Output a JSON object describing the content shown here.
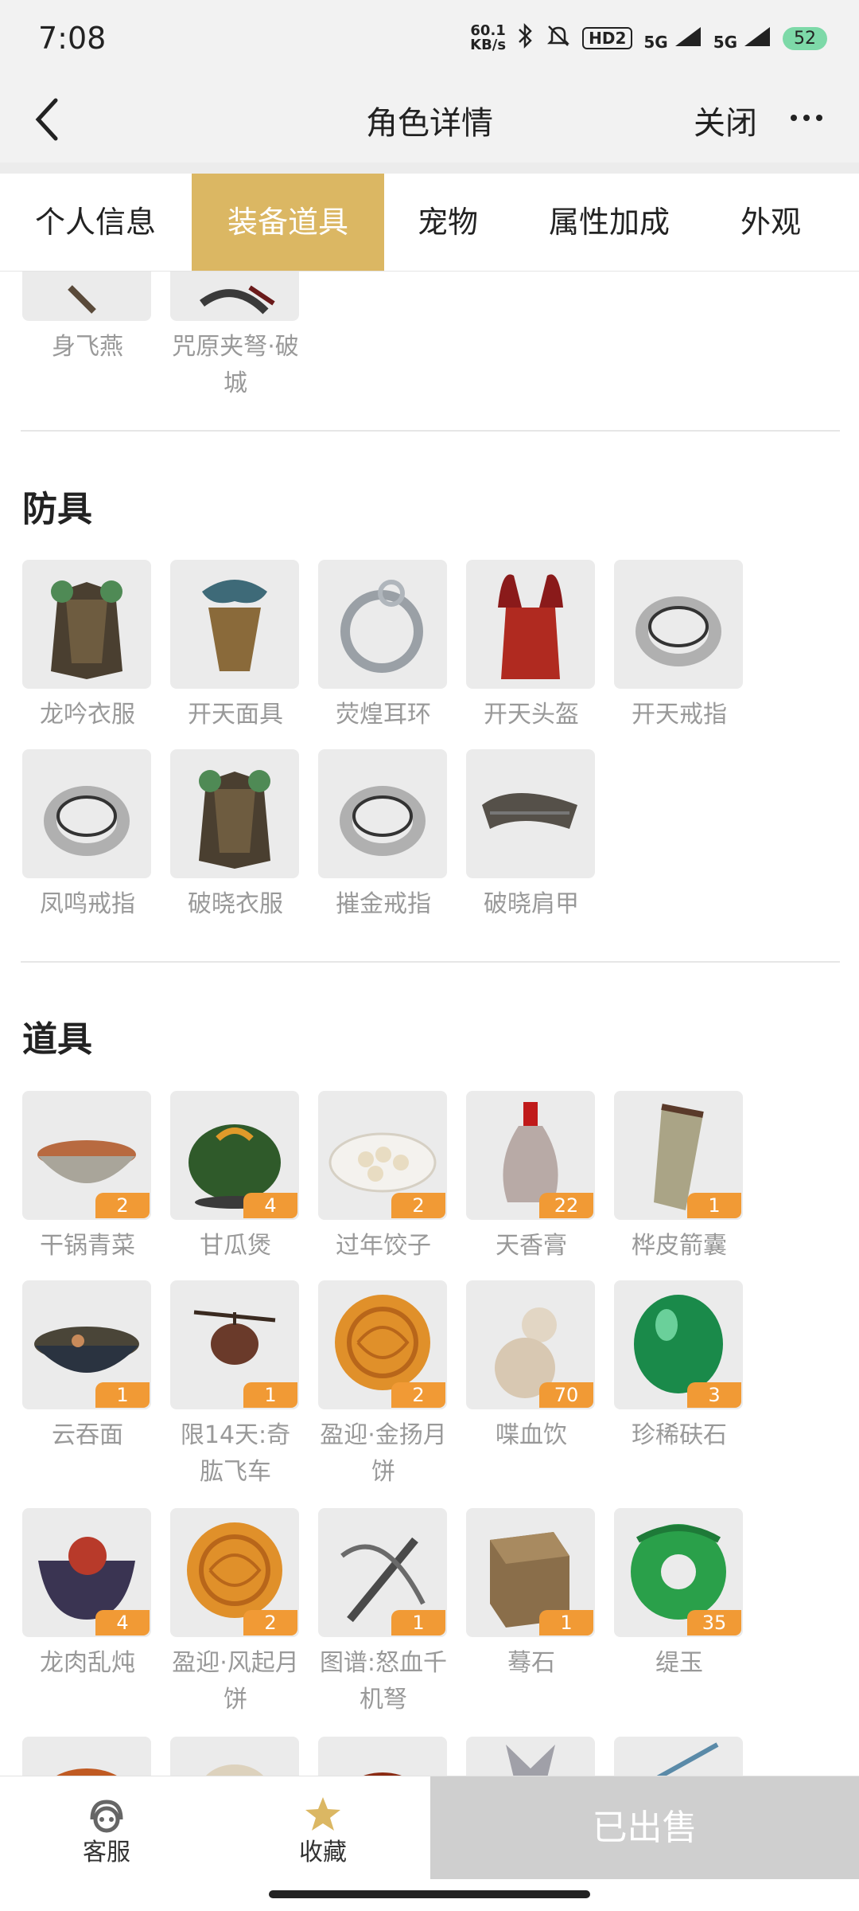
{
  "status_bar": {
    "time": "7:08",
    "net_speed": "60.1",
    "net_unit": "KB/s",
    "hd": "HD2",
    "sig1": "5G",
    "sig2": "5G",
    "battery": "52"
  },
  "nav": {
    "title": "角色详情",
    "close": "关闭"
  },
  "tabs": [
    "个人信息",
    "装备道具",
    "宠物",
    "属性加成",
    "外观"
  ],
  "active_tab": "装备道具",
  "weapons_partial": [
    {
      "name": "身飞燕"
    },
    {
      "name": "咒原夹弩·破城"
    }
  ],
  "armor": {
    "title": "防具",
    "items": [
      {
        "name": "龙吟衣服",
        "icon": "armor-icon"
      },
      {
        "name": "开天面具",
        "icon": "mask-icon"
      },
      {
        "name": "荧煌耳环",
        "icon": "earring-icon"
      },
      {
        "name": "开天头盔",
        "icon": "helmet-icon"
      },
      {
        "name": "开天戒指",
        "icon": "ring-icon"
      },
      {
        "name": "凤鸣戒指",
        "icon": "ring-icon"
      },
      {
        "name": "破晓衣服",
        "icon": "armor-icon"
      },
      {
        "name": "摧金戒指",
        "icon": "ring-icon"
      },
      {
        "name": "破晓肩甲",
        "icon": "shoulder-icon"
      }
    ]
  },
  "props": {
    "title": "道具",
    "items": [
      {
        "name": "干锅青菜",
        "count": "2",
        "icon": "bowl-icon"
      },
      {
        "name": "甘瓜煲",
        "count": "4",
        "icon": "pumpkin-icon"
      },
      {
        "name": "过年饺子",
        "count": "2",
        "icon": "dumpling-icon"
      },
      {
        "name": "天香膏",
        "count": "22",
        "icon": "vase-icon"
      },
      {
        "name": "桦皮箭囊",
        "count": "1",
        "icon": "quiver-icon"
      },
      {
        "name": "云吞面",
        "count": "1",
        "icon": "noodle-icon"
      },
      {
        "name": "限14天:奇肱飞车",
        "count": "1",
        "icon": "flying-car-icon"
      },
      {
        "name": "盈迎·金扬月饼",
        "count": "2",
        "icon": "mooncake-icon"
      },
      {
        "name": "喋血饮",
        "count": "70",
        "icon": "gourd-icon"
      },
      {
        "name": "珍稀砆石",
        "count": "3",
        "icon": "gem-icon"
      },
      {
        "name": "龙肉乱炖",
        "count": "4",
        "icon": "pot-icon"
      },
      {
        "name": "盈迎·风起月饼",
        "count": "2",
        "icon": "mooncake-icon"
      },
      {
        "name": "图谱:怒血千机弩",
        "count": "1",
        "icon": "crossbow-icon"
      },
      {
        "name": "蓦石",
        "count": "1",
        "icon": "stone-icon"
      },
      {
        "name": "缇玉",
        "count": "35",
        "icon": "jade-icon"
      }
    ]
  },
  "bottom": {
    "service": "客服",
    "favorite": "收藏",
    "sold": "已出售"
  },
  "colors": {
    "accent": "#dbb763",
    "badge": "#f19a35",
    "sold_bg": "#cfcfcf"
  }
}
